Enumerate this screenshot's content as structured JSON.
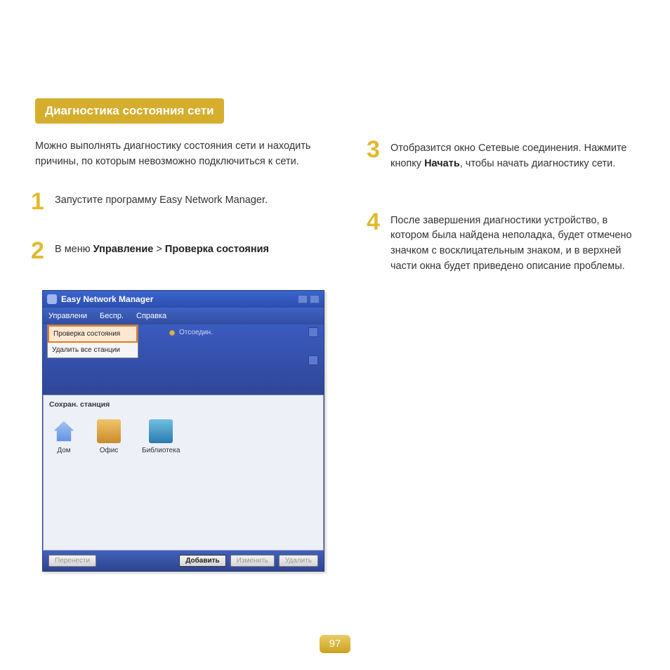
{
  "heading": "Диагностика состояния сети",
  "intro": "Можно выполнять диагностику состояния сети и находить причины, по которым невозможно подключиться к сети.",
  "steps": {
    "s1": "Запустите программу Easy Network Manager.",
    "s2_pre": "В меню ",
    "s2_b1": "Управление",
    "s2_mid": " > ",
    "s2_b2": "Проверка состояния",
    "s3_pre": "Отобразится окно Сетевые соединения. Нажмите кнопку ",
    "s3_b": "Начать",
    "s3_post": ", чтобы начать диагностику сети.",
    "s4": "После завершения диагностики устройство, в котором была найдена неполадка, будет отмечено значком с восклицательным знаком, и в верхней части окна будет приведено описание проблемы."
  },
  "app": {
    "title": "Easy Network Manager",
    "menu": {
      "m1": "Управлени",
      "m2": "Беспр.",
      "m3": "Справка"
    },
    "dropdown": {
      "i1": "Проверка состояния",
      "i2": "Удалить все станции"
    },
    "status": "Отсоедин.",
    "saved_title": "Сохран. станция",
    "stations": {
      "home": "Дом",
      "office": "Офис",
      "lib": "Библиотека"
    },
    "buttons": {
      "move": "Перенести",
      "add": "Добавить",
      "edit": "Изменить",
      "del": "Удалить"
    }
  },
  "page_number": "97"
}
